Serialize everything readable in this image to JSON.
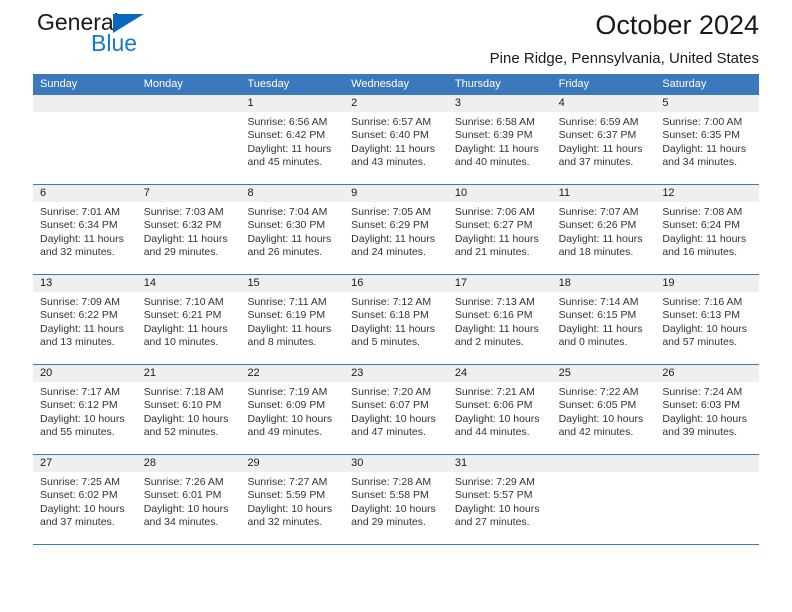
{
  "brand": {
    "word1": "General",
    "word2": "Blue",
    "accent_color": "#1878c8",
    "triangle_color": "#0a66c2"
  },
  "header": {
    "title": "October 2024",
    "subtitle": "Pine Ridge, Pennsylvania, United States"
  },
  "calendar": {
    "header_color": "#3c78bc",
    "weekdays": [
      "Sunday",
      "Monday",
      "Tuesday",
      "Wednesday",
      "Thursday",
      "Friday",
      "Saturday"
    ],
    "labels": {
      "sunrise": "Sunrise:",
      "sunset": "Sunset:",
      "daylight": "Daylight:"
    },
    "weeks": [
      [
        {
          "day": "",
          "empty": true
        },
        {
          "day": "",
          "empty": true
        },
        {
          "day": "1",
          "sunrise": "Sunrise: 6:56 AM",
          "sunset": "Sunset: 6:42 PM",
          "daylight": "Daylight: 11 hours and 45 minutes."
        },
        {
          "day": "2",
          "sunrise": "Sunrise: 6:57 AM",
          "sunset": "Sunset: 6:40 PM",
          "daylight": "Daylight: 11 hours and 43 minutes."
        },
        {
          "day": "3",
          "sunrise": "Sunrise: 6:58 AM",
          "sunset": "Sunset: 6:39 PM",
          "daylight": "Daylight: 11 hours and 40 minutes."
        },
        {
          "day": "4",
          "sunrise": "Sunrise: 6:59 AM",
          "sunset": "Sunset: 6:37 PM",
          "daylight": "Daylight: 11 hours and 37 minutes."
        },
        {
          "day": "5",
          "sunrise": "Sunrise: 7:00 AM",
          "sunset": "Sunset: 6:35 PM",
          "daylight": "Daylight: 11 hours and 34 minutes."
        }
      ],
      [
        {
          "day": "6",
          "sunrise": "Sunrise: 7:01 AM",
          "sunset": "Sunset: 6:34 PM",
          "daylight": "Daylight: 11 hours and 32 minutes."
        },
        {
          "day": "7",
          "sunrise": "Sunrise: 7:03 AM",
          "sunset": "Sunset: 6:32 PM",
          "daylight": "Daylight: 11 hours and 29 minutes."
        },
        {
          "day": "8",
          "sunrise": "Sunrise: 7:04 AM",
          "sunset": "Sunset: 6:30 PM",
          "daylight": "Daylight: 11 hours and 26 minutes."
        },
        {
          "day": "9",
          "sunrise": "Sunrise: 7:05 AM",
          "sunset": "Sunset: 6:29 PM",
          "daylight": "Daylight: 11 hours and 24 minutes."
        },
        {
          "day": "10",
          "sunrise": "Sunrise: 7:06 AM",
          "sunset": "Sunset: 6:27 PM",
          "daylight": "Daylight: 11 hours and 21 minutes."
        },
        {
          "day": "11",
          "sunrise": "Sunrise: 7:07 AM",
          "sunset": "Sunset: 6:26 PM",
          "daylight": "Daylight: 11 hours and 18 minutes."
        },
        {
          "day": "12",
          "sunrise": "Sunrise: 7:08 AM",
          "sunset": "Sunset: 6:24 PM",
          "daylight": "Daylight: 11 hours and 16 minutes."
        }
      ],
      [
        {
          "day": "13",
          "sunrise": "Sunrise: 7:09 AM",
          "sunset": "Sunset: 6:22 PM",
          "daylight": "Daylight: 11 hours and 13 minutes."
        },
        {
          "day": "14",
          "sunrise": "Sunrise: 7:10 AM",
          "sunset": "Sunset: 6:21 PM",
          "daylight": "Daylight: 11 hours and 10 minutes."
        },
        {
          "day": "15",
          "sunrise": "Sunrise: 7:11 AM",
          "sunset": "Sunset: 6:19 PM",
          "daylight": "Daylight: 11 hours and 8 minutes."
        },
        {
          "day": "16",
          "sunrise": "Sunrise: 7:12 AM",
          "sunset": "Sunset: 6:18 PM",
          "daylight": "Daylight: 11 hours and 5 minutes."
        },
        {
          "day": "17",
          "sunrise": "Sunrise: 7:13 AM",
          "sunset": "Sunset: 6:16 PM",
          "daylight": "Daylight: 11 hours and 2 minutes."
        },
        {
          "day": "18",
          "sunrise": "Sunrise: 7:14 AM",
          "sunset": "Sunset: 6:15 PM",
          "daylight": "Daylight: 11 hours and 0 minutes."
        },
        {
          "day": "19",
          "sunrise": "Sunrise: 7:16 AM",
          "sunset": "Sunset: 6:13 PM",
          "daylight": "Daylight: 10 hours and 57 minutes."
        }
      ],
      [
        {
          "day": "20",
          "sunrise": "Sunrise: 7:17 AM",
          "sunset": "Sunset: 6:12 PM",
          "daylight": "Daylight: 10 hours and 55 minutes."
        },
        {
          "day": "21",
          "sunrise": "Sunrise: 7:18 AM",
          "sunset": "Sunset: 6:10 PM",
          "daylight": "Daylight: 10 hours and 52 minutes."
        },
        {
          "day": "22",
          "sunrise": "Sunrise: 7:19 AM",
          "sunset": "Sunset: 6:09 PM",
          "daylight": "Daylight: 10 hours and 49 minutes."
        },
        {
          "day": "23",
          "sunrise": "Sunrise: 7:20 AM",
          "sunset": "Sunset: 6:07 PM",
          "daylight": "Daylight: 10 hours and 47 minutes."
        },
        {
          "day": "24",
          "sunrise": "Sunrise: 7:21 AM",
          "sunset": "Sunset: 6:06 PM",
          "daylight": "Daylight: 10 hours and 44 minutes."
        },
        {
          "day": "25",
          "sunrise": "Sunrise: 7:22 AM",
          "sunset": "Sunset: 6:05 PM",
          "daylight": "Daylight: 10 hours and 42 minutes."
        },
        {
          "day": "26",
          "sunrise": "Sunrise: 7:24 AM",
          "sunset": "Sunset: 6:03 PM",
          "daylight": "Daylight: 10 hours and 39 minutes."
        }
      ],
      [
        {
          "day": "27",
          "sunrise": "Sunrise: 7:25 AM",
          "sunset": "Sunset: 6:02 PM",
          "daylight": "Daylight: 10 hours and 37 minutes."
        },
        {
          "day": "28",
          "sunrise": "Sunrise: 7:26 AM",
          "sunset": "Sunset: 6:01 PM",
          "daylight": "Daylight: 10 hours and 34 minutes."
        },
        {
          "day": "29",
          "sunrise": "Sunrise: 7:27 AM",
          "sunset": "Sunset: 5:59 PM",
          "daylight": "Daylight: 10 hours and 32 minutes."
        },
        {
          "day": "30",
          "sunrise": "Sunrise: 7:28 AM",
          "sunset": "Sunset: 5:58 PM",
          "daylight": "Daylight: 10 hours and 29 minutes."
        },
        {
          "day": "31",
          "sunrise": "Sunrise: 7:29 AM",
          "sunset": "Sunset: 5:57 PM",
          "daylight": "Daylight: 10 hours and 27 minutes."
        },
        {
          "day": "",
          "empty": true
        },
        {
          "day": "",
          "empty": true
        }
      ]
    ]
  }
}
